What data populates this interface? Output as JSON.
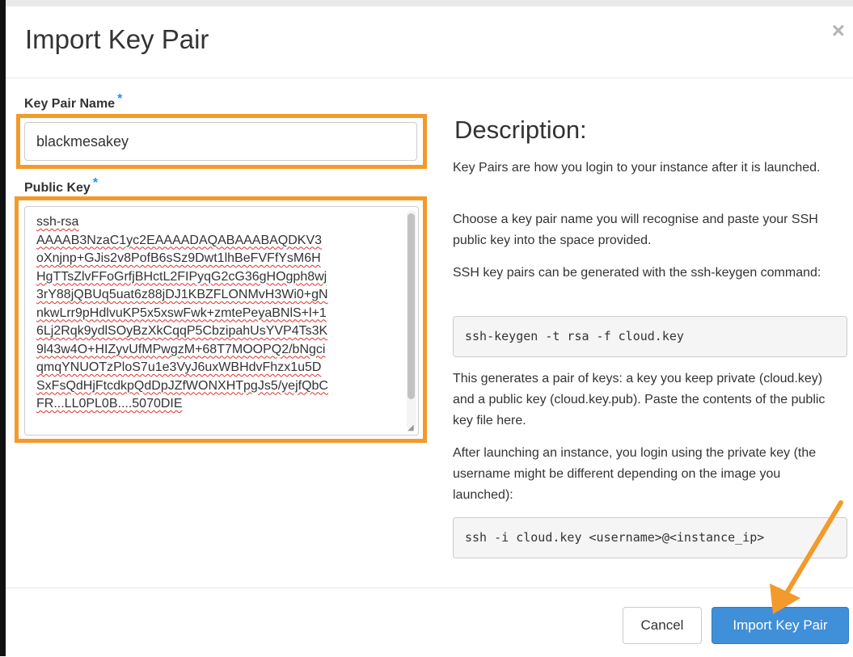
{
  "modal": {
    "title": "Import Key Pair",
    "close_glyph": "×"
  },
  "form": {
    "name_label": "Key Pair Name",
    "name_required": "*",
    "name_value": "blackmesakey",
    "key_label": "Public Key",
    "key_required": "*",
    "key_lines": [
      "ssh-rsa",
      "AAAAB3NzaC1yc2EAAAADAQABAAABAQDKV3",
      "oXnjnp+GJis2v8PofB6sSz9Dwt1lhBeFVFfYsM6H",
      "HgTTsZlvFFoGrfjBHctL2FIPyqG2cG36gHOgph8wj",
      "3rY88jQBUq5uat6z88jDJ1KBZFLONMvH3Wi0+gN",
      "nkwLrr9pHdlvuKP5x5xswFwk+zmtePeyaBNlS+l+1",
      "6Lj2Rqk9ydlSOyBzXkCqqP5CbzipahUsYVP4Ts3K",
      "9l43w4O+HIZyvUfMPwgzM+68T7MOOPQ2/bNgci",
      "qmqYNUOTzPloS7u1e3VyJ6uxWBHdvFhzx1u5D",
      "SxFsQdHjFtcdkpQdDpJZfWONXHTpgJs5/yejfQbC",
      "FR...LL0PL0B....5070DIE"
    ]
  },
  "description": {
    "heading": "Description:",
    "p1": "Key Pairs are how you login to your instance after it is launched.",
    "p2": "Choose a key pair name you will recognise and paste your SSH public key into the space provided.",
    "p3": "SSH key pairs can be generated with the ssh-keygen command:",
    "code1": "ssh-keygen -t rsa -f cloud.key",
    "p4": "This generates a pair of keys: a key you keep private (cloud.key) and a public key (cloud.key.pub). Paste the contents of the public key file here.",
    "p5": "After launching an instance, you login using the private key (the username might be different depending on the image you launched):",
    "code2": "ssh -i cloud.key <username>@<instance_ip>"
  },
  "footer": {
    "cancel_label": "Cancel",
    "submit_label": "Import Key Pair"
  },
  "colors": {
    "highlight": "#f39a2a",
    "primary": "#3f8fd9",
    "required": "#1e90ff"
  }
}
